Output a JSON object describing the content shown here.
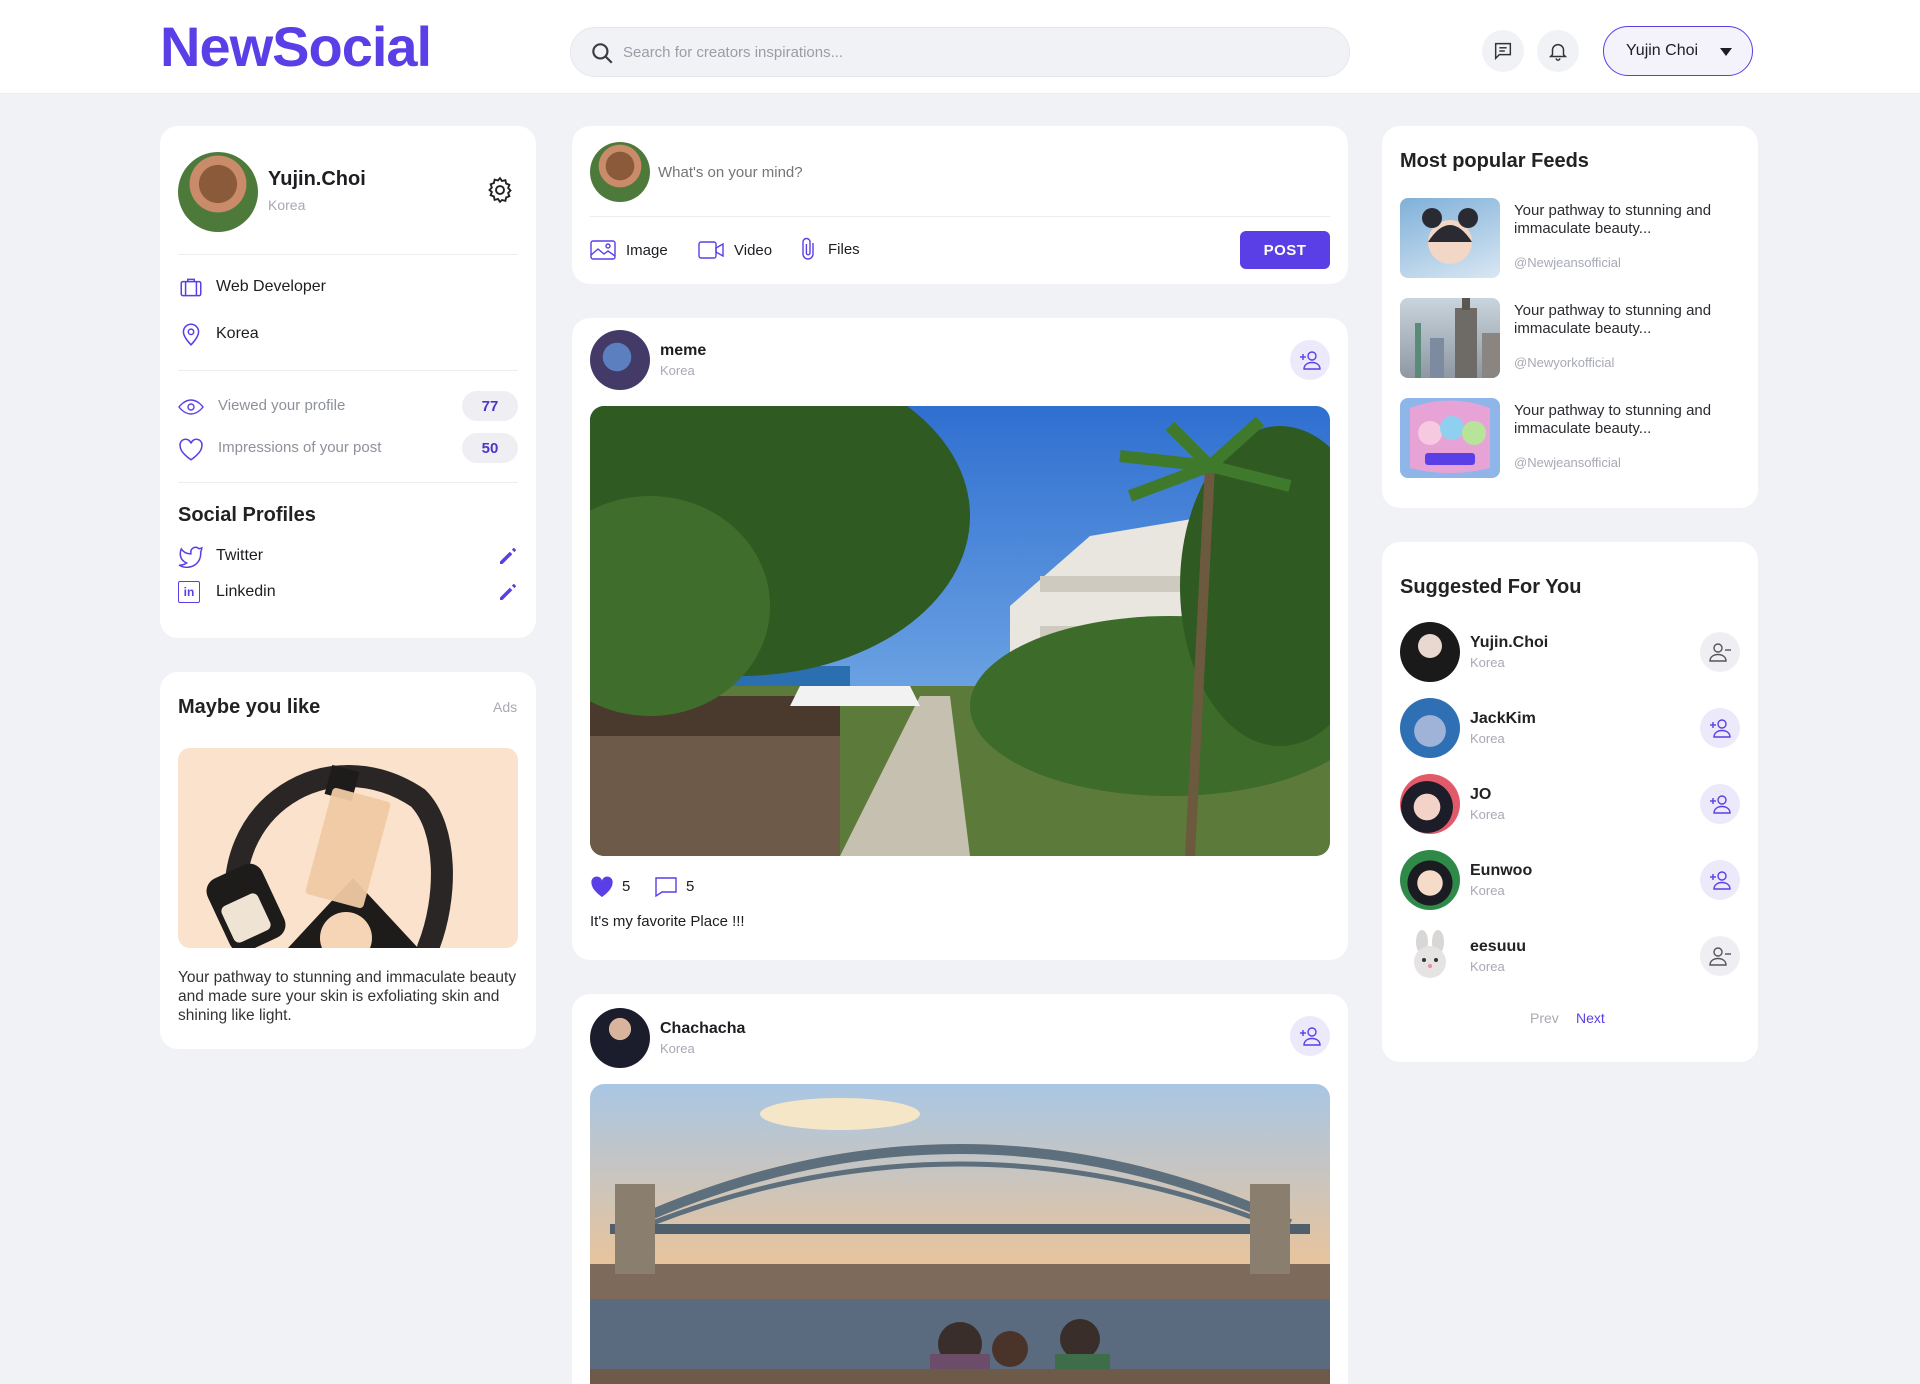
{
  "header": {
    "logo": "NewSocial",
    "search_placeholder": "Search for creators inspirations...",
    "user_name": "Yujin Choi"
  },
  "profile": {
    "name": "Yujin.Choi",
    "location": "Korea",
    "job": "Web Developer",
    "place": "Korea",
    "stats": [
      {
        "label": "Viewed your profile",
        "value": "77"
      },
      {
        "label": "Impressions of your post",
        "value": "50"
      }
    ],
    "social_title": "Social Profiles",
    "social": [
      {
        "label": "Twitter"
      },
      {
        "label": "Linkedin"
      }
    ]
  },
  "ads": {
    "title": "Maybe you like",
    "tag": "Ads",
    "text": "Your pathway to stunning and immaculate beauty and made sure your skin is exfoliating skin and shining like light."
  },
  "composer": {
    "placeholder": "What's on your mind?",
    "actions": [
      "Image",
      "Video",
      "Files"
    ],
    "post_label": "POST"
  },
  "posts": [
    {
      "author": "meme",
      "location": "Korea",
      "likes": "5",
      "comments": "5",
      "caption": "It's my favorite Place !!!"
    },
    {
      "author": "Chachacha",
      "location": "Korea"
    }
  ],
  "popular": {
    "title": "Most popular Feeds",
    "items": [
      {
        "text": "Your pathway to stunning and immaculate beauty...",
        "handle": "@Newjeansofficial"
      },
      {
        "text": "Your pathway to stunning and immaculate beauty...",
        "handle": "@Newyorkofficial"
      },
      {
        "text": "Your pathway to stunning and immaculate beauty...",
        "handle": "@Newjeansofficial"
      }
    ]
  },
  "suggested": {
    "title": "Suggested For You",
    "items": [
      {
        "name": "Yujin.Choi",
        "location": "Korea",
        "followed": true
      },
      {
        "name": "JackKim",
        "location": "Korea",
        "followed": false
      },
      {
        "name": "JO",
        "location": "Korea",
        "followed": false
      },
      {
        "name": "Eunwoo",
        "location": "Korea",
        "followed": false
      },
      {
        "name": "eesuuu",
        "location": "Korea",
        "followed": true
      }
    ],
    "prev": "Prev",
    "next": "Next"
  },
  "colors": {
    "accent": "#5a3fe6",
    "background": "#f1f2f6"
  }
}
